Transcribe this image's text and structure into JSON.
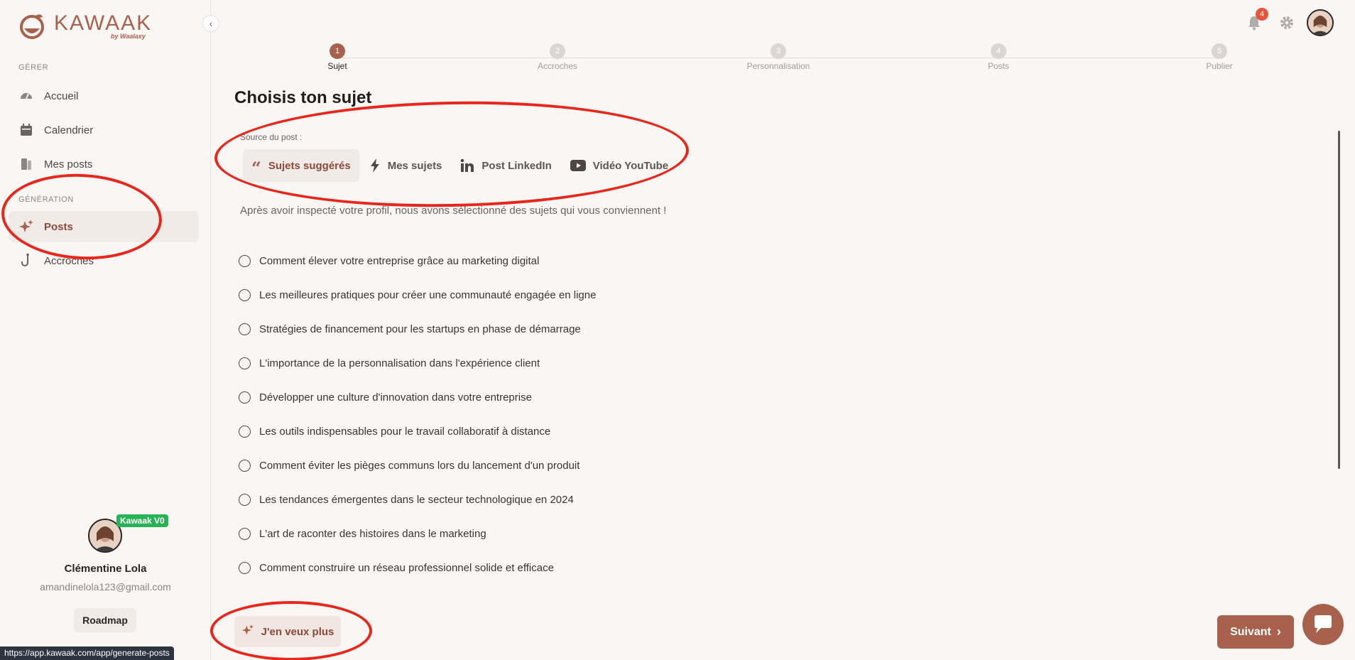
{
  "app": {
    "logo_text": "KAWAAK",
    "logo_sub": "by Waalaxy",
    "status_url": "https://app.kawaak.com/app/generate-posts"
  },
  "sidebar": {
    "section_manage": "GÉRER",
    "section_generation": "GÉNÉRATION",
    "items": [
      {
        "label": "Accueil",
        "icon": "dashboard-icon"
      },
      {
        "label": "Calendrier",
        "icon": "calendar-icon"
      },
      {
        "label": "Mes posts",
        "icon": "posts-icon"
      },
      {
        "label": "Posts",
        "icon": "sparkle-icon",
        "active": true
      },
      {
        "label": "Accroches",
        "icon": "hook-icon"
      }
    ],
    "profile": {
      "badge": "Kawaak V0",
      "name": "Clémentine Lola",
      "email": "amandinelola123@gmail.com",
      "roadmap": "Roadmap"
    }
  },
  "topbar": {
    "notifications_count": "4"
  },
  "stepper": {
    "steps": [
      {
        "num": "1",
        "label": "Sujet",
        "active": true
      },
      {
        "num": "2",
        "label": "Accroches"
      },
      {
        "num": "3",
        "label": "Personnalisation"
      },
      {
        "num": "4",
        "label": "Posts"
      },
      {
        "num": "5",
        "label": "Publier"
      }
    ]
  },
  "main": {
    "title": "Choisis ton sujet",
    "source_label": "Source du post :",
    "tabs": [
      {
        "label": "Sujets suggérés",
        "icon": "quote-icon",
        "active": true
      },
      {
        "label": "Mes sujets",
        "icon": "lightning-icon"
      },
      {
        "label": "Post LinkedIn",
        "icon": "linkedin-icon"
      },
      {
        "label": "Vidéo YouTube",
        "icon": "youtube-icon"
      }
    ],
    "intro": "Après avoir inspecté votre profil, nous avons sélectionné des sujets qui vous conviennent !",
    "topics": [
      "Comment élever votre entreprise grâce au marketing digital",
      "Les meilleures pratiques pour créer une communauté engagée en ligne",
      "Stratégies de financement pour les startups en phase de démarrage",
      "L'importance de la personnalisation dans l'expérience client",
      "Développer une culture d'innovation dans votre entreprise",
      "Les outils indispensables pour le travail collaboratif à distance",
      "Comment éviter les pièges communs lors du lancement d'un produit",
      "Les tendances émergentes dans le secteur technologique en 2024",
      "L'art de raconter des histoires dans le marketing",
      "Comment construire un réseau professionnel solide et efficace"
    ],
    "more_button": "J'en veux plus",
    "next_button": "Suivant"
  },
  "colors": {
    "accent": "#a8614c",
    "annotation": "#e8261b"
  }
}
